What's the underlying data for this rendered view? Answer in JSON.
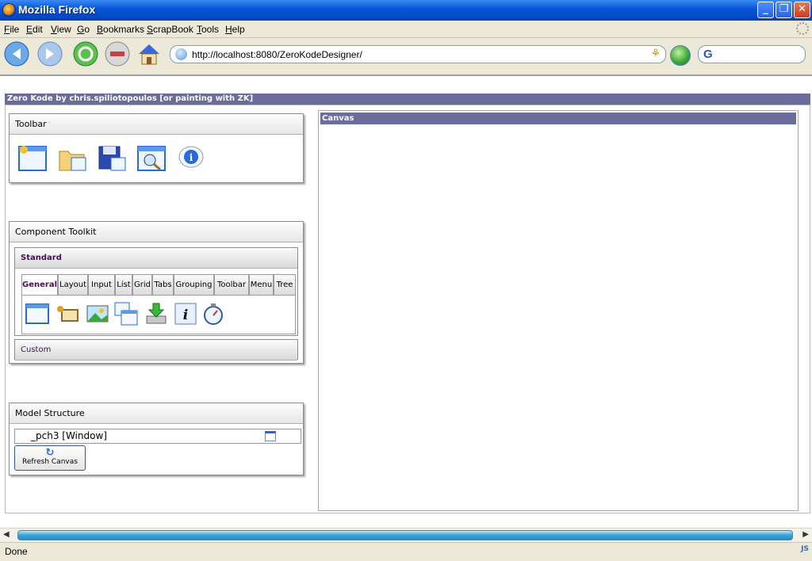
{
  "window": {
    "title": "Mozilla Firefox"
  },
  "menu": [
    "File",
    "Edit",
    "View",
    "Go",
    "Bookmarks",
    "ScrapBook",
    "Tools",
    "Help"
  ],
  "address": {
    "url": "http://localhost:8080/ZeroKodeDesigner/"
  },
  "search": {
    "engine_glyph": "G"
  },
  "app": {
    "header": "Zero Kode by chris.spiliotopoulos [or painting with ZK]",
    "toolbar_panel": {
      "title": "Toolbar",
      "icons": [
        "new-window-icon",
        "open-folder-icon",
        "save-disk-icon",
        "preview-icon",
        "info-bubble-icon"
      ]
    },
    "component_toolkit": {
      "title": "Component Toolkit",
      "standard_title": "Standard",
      "custom_title": "Custom",
      "tabs": [
        "General",
        "Layout",
        "Input",
        "List",
        "Grid",
        "Tabs",
        "Grouping",
        "Toolbar",
        "Menu",
        "Tree"
      ],
      "selected_tab": "General",
      "components": [
        "window-icon",
        "label-icon",
        "image-icon",
        "include-icon",
        "fileupload-icon",
        "info-icon",
        "timer-icon"
      ]
    },
    "model_structure": {
      "title": "Model Structure",
      "tree_item": "_pch3 [Window]",
      "refresh_button": "Refresh Canvas"
    },
    "canvas": {
      "title": "Canvas"
    }
  },
  "status": {
    "text": "Done"
  },
  "colors": {
    "header_bar": "#6b6b9c",
    "titlebar_blue": "#0a58d8",
    "tab_text": "#4a0a5e"
  }
}
